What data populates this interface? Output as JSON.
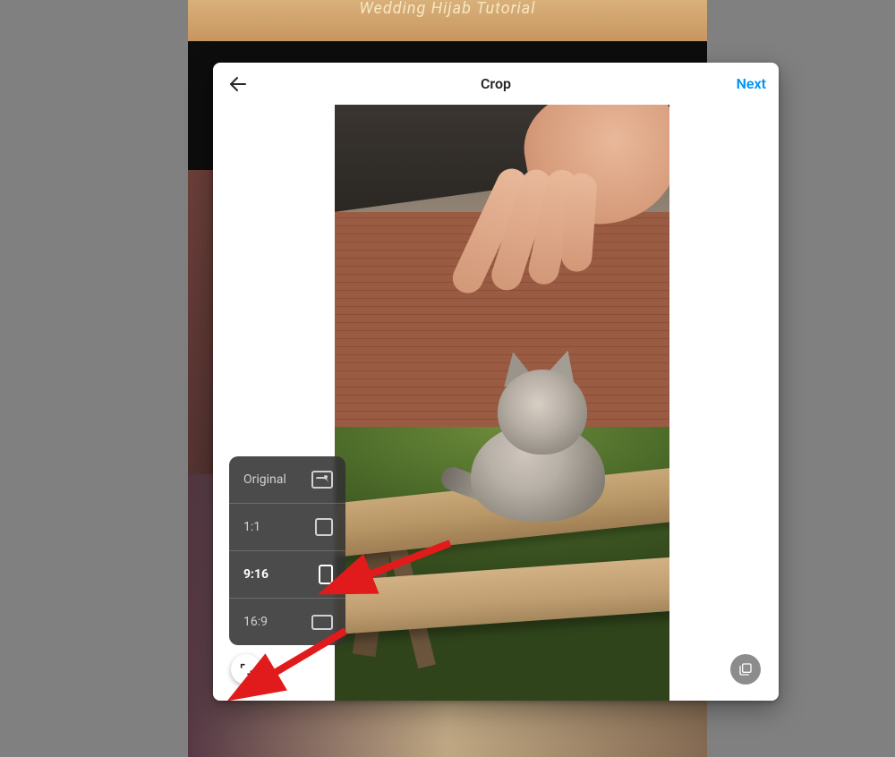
{
  "background_banner_text": "Wedding Hijab Tutorial",
  "header": {
    "title": "Crop",
    "next_label": "Next"
  },
  "aspect_menu": {
    "items": [
      {
        "label": "Original",
        "key": "original"
      },
      {
        "label": "1:1",
        "key": "1-1"
      },
      {
        "label": "9:16",
        "key": "9-16"
      },
      {
        "label": "16:9",
        "key": "16-9"
      }
    ],
    "selected_key": "9-16"
  },
  "colors": {
    "accent": "#0095f6",
    "annotation_arrow": "#e11b1b"
  },
  "image_description": "A grey tabby kitten sitting on a wooden bench outdoors with a person's hand reaching toward it; brick wall and grass in the background."
}
